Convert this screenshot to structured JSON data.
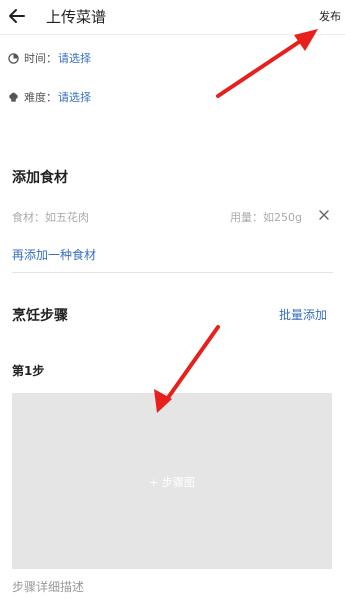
{
  "header": {
    "title": "上传菜谱",
    "publish_label": "发布",
    "back_icon": "arrow-left-icon"
  },
  "options": {
    "time": {
      "label": "时间：",
      "value": "请选择",
      "icon": "clock-icon"
    },
    "difficulty": {
      "label": "难度：",
      "value": "请选择",
      "icon": "chef-hat-icon"
    }
  },
  "ingredients": {
    "title": "添加食材",
    "name_placeholder": "食材：如五花肉",
    "amount_placeholder": "用量：如250g",
    "remove_icon": "close-icon",
    "add_more_label": "再添加一种食材"
  },
  "steps": {
    "title": "烹饪步骤",
    "batch_add_label": "批量添加",
    "step_label": "第1步",
    "image_placeholder": "+ 步骤图",
    "description_placeholder": "步骤详细描述"
  },
  "colors": {
    "link": "#3a6fbf",
    "annotation_arrow": "#e8201c",
    "image_placeholder_bg": "#e5e5e5"
  }
}
